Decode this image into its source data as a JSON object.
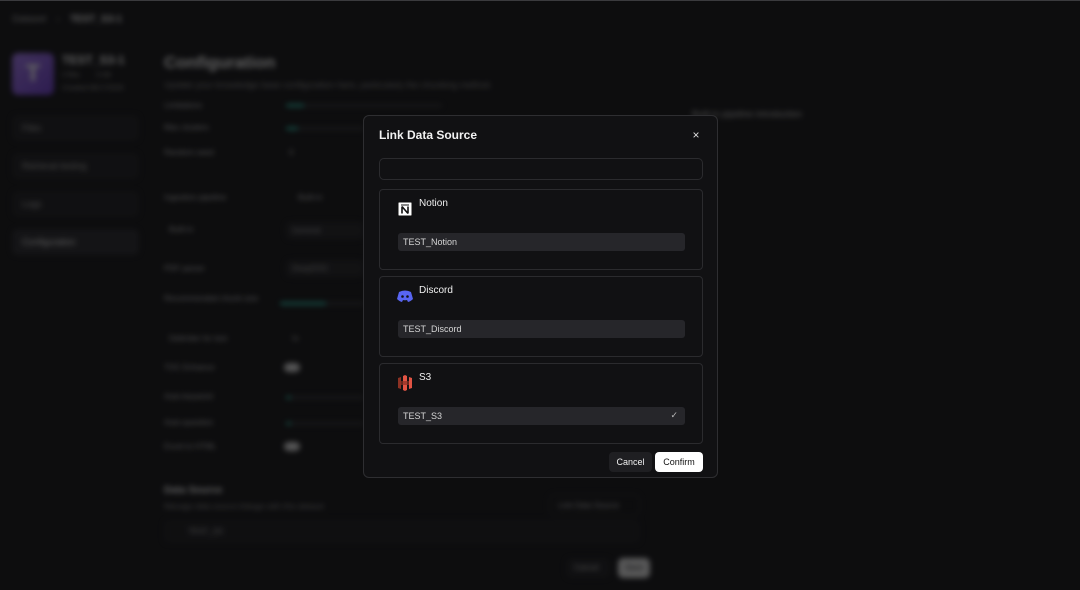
{
  "background": {
    "breadcrumb": [
      "Dataset",
      "TEST_S3-1"
    ],
    "kb": {
      "initial": "T",
      "name": "TEST_S3-1",
      "files": "0 files",
      "size": "0 KB",
      "created": "Created 06/17/2025"
    },
    "nav": [
      "Files",
      "Retrieval testing",
      "Logs",
      "Configuration"
    ],
    "config": {
      "title": "Configuration",
      "subtitle": "Update your knowledge base configuration here, particularly the chunking method.",
      "rows": [
        "Limitations",
        "Max clusters",
        "Random seed",
        "Ingestion pipeline",
        "Built-in",
        "PDF parser",
        "Recommended chunk size",
        "Delimiter for text",
        "TOC Enhance",
        "Auto-keyword",
        "Auto-question",
        "Excel to HTML"
      ],
      "ingestion_value": "Built-in",
      "builtin_value": "General",
      "parser_value": "DeepDOC",
      "random_seed": "0",
      "delimiter": "\\n"
    },
    "side_link": "Built-in pipeline introduction",
    "data_source": {
      "title": "Data Source",
      "subtitle": "Manage data source linkage with this dataset",
      "link_label": "Link Data Source",
      "row": "TEST_S3"
    },
    "cancel_label": "Cancel",
    "save_label": "Save"
  },
  "modal": {
    "title": "Link Data Source",
    "close_glyph": "×",
    "search": {
      "value": "",
      "placeholder": ""
    },
    "sources": [
      {
        "name": "Notion",
        "icon": "notion-icon",
        "value": "TEST_Notion",
        "selected": false
      },
      {
        "name": "Discord",
        "icon": "discord-icon",
        "value": "TEST_Discord",
        "selected": false
      },
      {
        "name": "S3",
        "icon": "s3-icon",
        "value": "TEST_S3",
        "selected": true
      }
    ],
    "check_glyph": "✓",
    "cancel_label": "Cancel",
    "confirm_label": "Confirm"
  },
  "colors": {
    "accent": "#2fc8b0",
    "discord": "#5865f2",
    "s3": "#e25444"
  }
}
